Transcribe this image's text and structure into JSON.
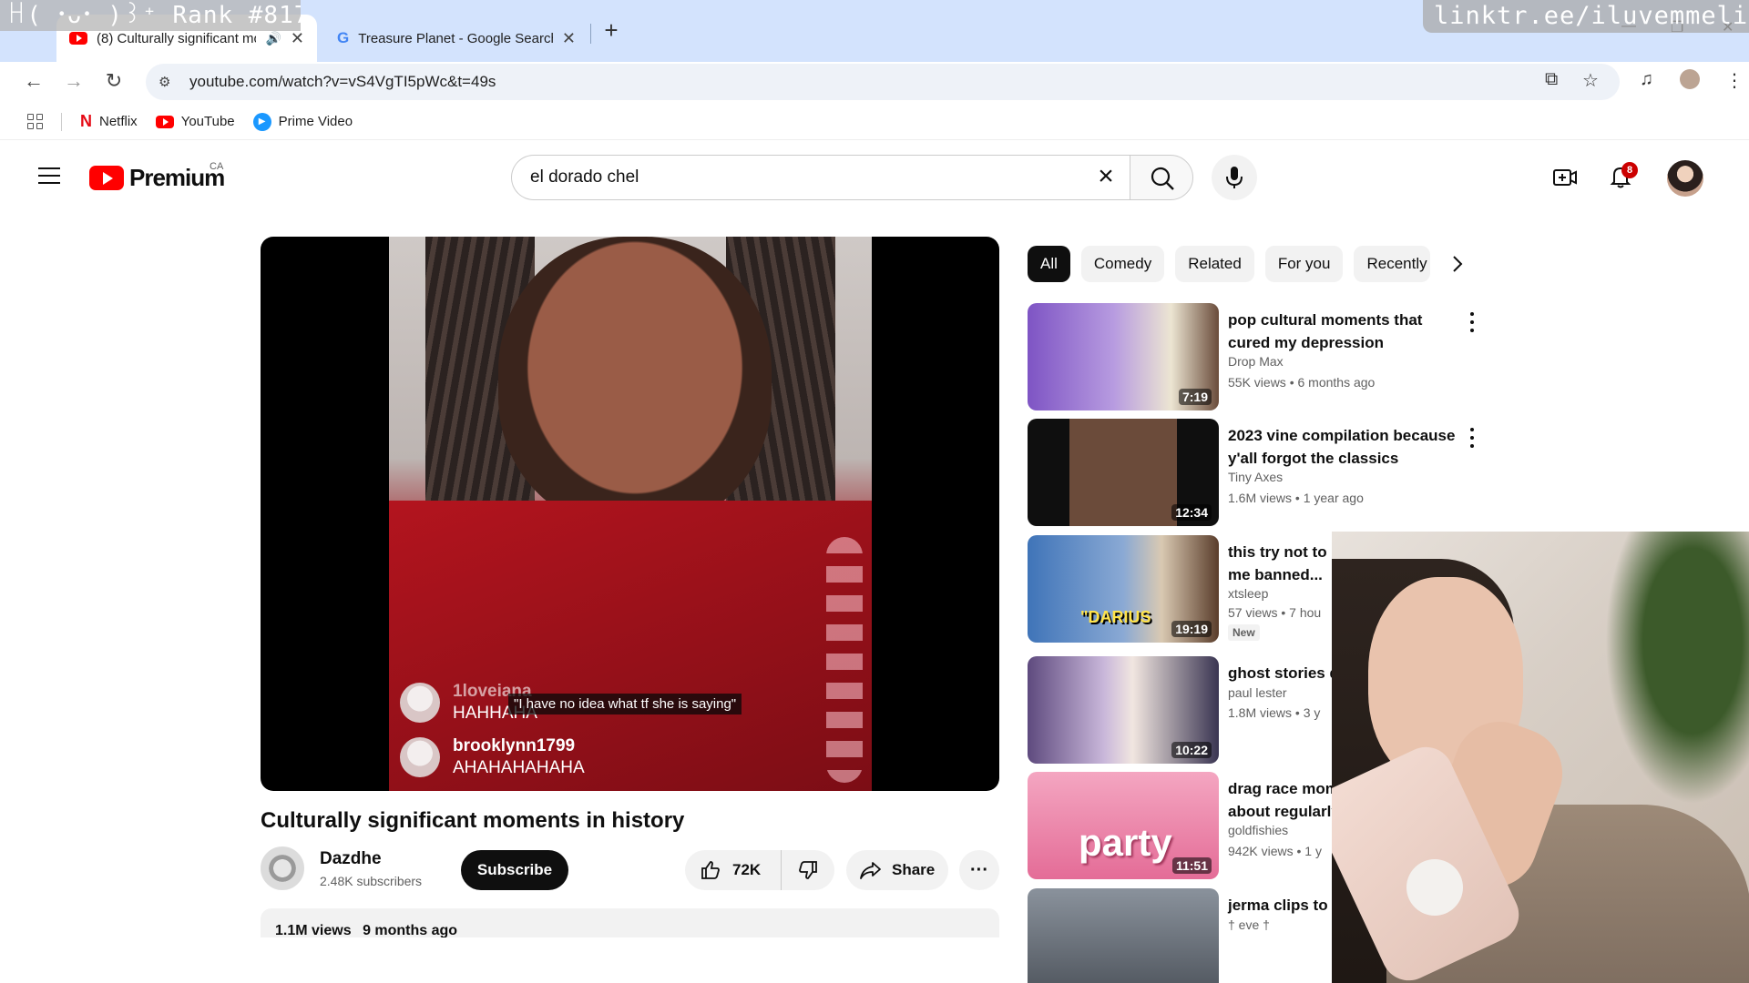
{
  "overlay": {
    "rank": "ꀿ( ･ᴗ･ )꒱⁺ Rank #817",
    "link": "linktr.ee/iluvemmeline"
  },
  "browser": {
    "tabs": [
      {
        "title": "(8) Culturally significant mo",
        "active": true,
        "audio": true
      },
      {
        "title": "Treasure Planet - Google Search",
        "active": false
      }
    ],
    "new_tab": "+",
    "url": "youtube.com/watch?v=vS4VgTI5pWc&t=49s",
    "bookmarks": [
      {
        "label": "Netflix"
      },
      {
        "label": "YouTube"
      },
      {
        "label": "Prime Video"
      }
    ]
  },
  "youtube": {
    "logo_text": "Premium",
    "region": "CA",
    "search_query": "el dorado chel",
    "notifications": "8"
  },
  "player": {
    "chat": [
      {
        "user": "1loveiana",
        "message": "HAHHAHA"
      },
      {
        "user": "brooklynn1799",
        "message": "AHAHAHAHAHA"
      }
    ],
    "caption": "\"I have no idea what tf she is saying\""
  },
  "video": {
    "title": "Culturally significant moments in history",
    "channel": "Dazdhe",
    "subscribers": "2.48K subscribers",
    "subscribe_label": "Subscribe",
    "likes": "72K",
    "share_label": "Share",
    "more_label": "···",
    "views": "1.1M views",
    "age": "9 months ago"
  },
  "chips": [
    "All",
    "Comedy",
    "Related",
    "For you",
    "Recently uploaded"
  ],
  "recommendations": [
    {
      "title": "pop cultural moments that cured my depression",
      "channel": "Drop Max",
      "meta": "55K views • 6 months ago",
      "duration": "7:19",
      "thumb_color": "#8d63c9"
    },
    {
      "title": "2023 vine compilation because y'all forgot the classics",
      "channel": "Tiny Axes",
      "meta": "1.6M views • 1 year ago",
      "duration": "12:34",
      "thumb_color": "#2b2b2b"
    },
    {
      "title": "this try not to l",
      "title2": "me banned...",
      "channel": "xtsleep",
      "meta": "57 views • 7 hou",
      "badge": "New",
      "duration": "19:19",
      "thumb_text": "\"DARIUS",
      "thumb_color": "#4a7fbf"
    },
    {
      "title": "ghost stories d",
      "channel": "paul lester",
      "meta": "1.8M views • 3 y",
      "duration": "10:22",
      "thumb_color": "#7b5e9a"
    },
    {
      "title": "drag race mom",
      "title2": "about regularly",
      "channel": "goldfishies",
      "meta": "942K views • 1 y",
      "duration": "11:51",
      "thumb_text": "party",
      "thumb_color": "#e96f9a"
    },
    {
      "title": "jerma clips to r",
      "channel": "† eve †",
      "meta": "",
      "duration": "",
      "thumb_color": "#6b7380"
    }
  ]
}
